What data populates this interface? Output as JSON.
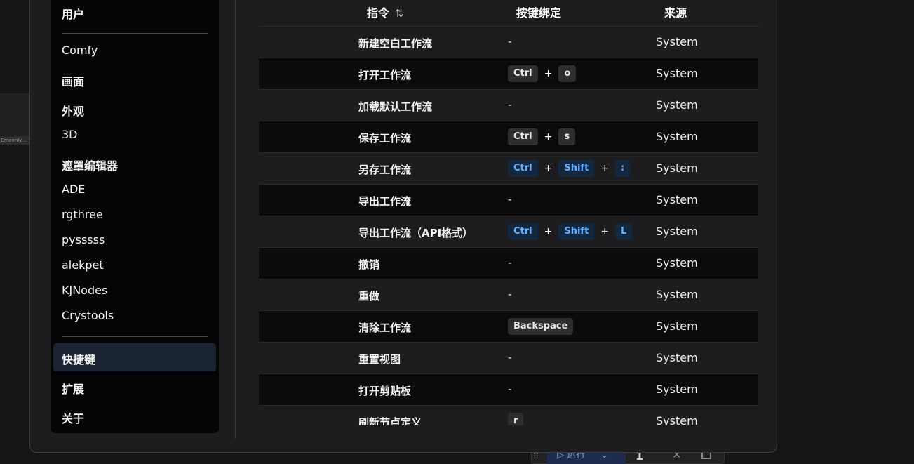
{
  "background": {
    "chip_text": "Emaonly...",
    "run_label": "运行",
    "queue_count": "1"
  },
  "sidebar": {
    "items": [
      {
        "label": "用户",
        "bold": true
      },
      {
        "label": "Comfy",
        "bold": false
      },
      {
        "label": "画面",
        "bold": true
      },
      {
        "label": "外观",
        "bold": true
      },
      {
        "label": "3D",
        "bold": false
      },
      {
        "label": "遮罩编辑器",
        "bold": true
      },
      {
        "label": "ADE",
        "bold": false
      },
      {
        "label": "rgthree",
        "bold": false
      },
      {
        "label": "pysssss",
        "bold": false
      },
      {
        "label": "alekpet",
        "bold": false
      },
      {
        "label": "KJNodes",
        "bold": false
      },
      {
        "label": "Crystools",
        "bold": false
      },
      {
        "label": "快捷键",
        "bold": true,
        "active": true
      },
      {
        "label": "扩展",
        "bold": true
      },
      {
        "label": "关于",
        "bold": true
      }
    ]
  },
  "table": {
    "headers": {
      "command": "指令",
      "sort_icon": "⇅",
      "keybinding": "按键绑定",
      "source": "来源"
    },
    "colors": {
      "key_gray": "#2e2e30",
      "key_blue": "#13283f",
      "key_blue_text": "#62b0ff"
    },
    "rows": [
      {
        "command": "新建空白工作流",
        "keys": [],
        "source": "System"
      },
      {
        "command": "打开工作流",
        "keys": [
          "Ctrl",
          "o"
        ],
        "style": "gray",
        "source": "System"
      },
      {
        "command": "加载默认工作流",
        "keys": [],
        "source": "System"
      },
      {
        "command": "保存工作流",
        "keys": [
          "Ctrl",
          "s"
        ],
        "style": "gray",
        "source": "System"
      },
      {
        "command": "另存工作流",
        "keys": [
          "Ctrl",
          "Shift",
          ":"
        ],
        "style": "blue",
        "source": "System"
      },
      {
        "command": "导出工作流",
        "keys": [],
        "source": "System"
      },
      {
        "command": "导出工作流（API格式）",
        "keys": [
          "Ctrl",
          "Shift",
          "L"
        ],
        "style": "blue",
        "source": "System"
      },
      {
        "command": "撤销",
        "keys": [],
        "source": "System"
      },
      {
        "command": "重做",
        "keys": [],
        "source": "System"
      },
      {
        "command": "清除工作流",
        "keys": [
          "Backspace"
        ],
        "style": "gray",
        "source": "System"
      },
      {
        "command": "重置视图",
        "keys": [],
        "source": "System"
      },
      {
        "command": "打开剪贴板",
        "keys": [],
        "source": "System"
      },
      {
        "command": "刷新节点定义",
        "keys": [
          "r"
        ],
        "style": "gray",
        "source": "System"
      }
    ],
    "empty_key_text": "-",
    "plus_text": "+"
  }
}
